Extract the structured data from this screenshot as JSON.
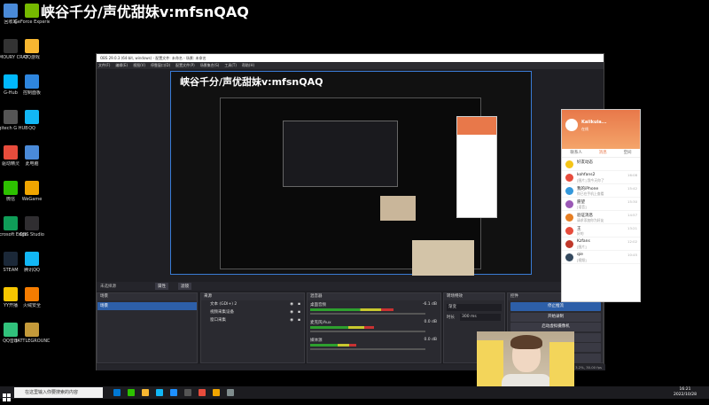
{
  "overlay": {
    "title": "峡谷千分/声优甜妹v:mfsnQAQ",
    "nested_title": "峡谷千分/声优甜妹v:mfsnQAQ"
  },
  "desktop_icons": [
    {
      "label": "回收站",
      "color": "#4a8ad8"
    },
    {
      "label": "GeForce Experience",
      "color": "#76b900"
    },
    {
      "label": "ARMOURY CRATE",
      "color": "#333"
    },
    {
      "label": "QQ游戏",
      "color": "#f7b731"
    },
    {
      "label": "G-Hub",
      "color": "#00b8fc"
    },
    {
      "label": "控制面板",
      "color": "#2e86de"
    },
    {
      "label": "Logitech G HUB",
      "color": "#555"
    },
    {
      "label": "QQ",
      "color": "#12b7f5"
    },
    {
      "label": "驱动精灵",
      "color": "#e74c3c"
    },
    {
      "label": "此电脑",
      "color": "#4a8ad8"
    },
    {
      "label": "微信",
      "color": "#2dc100"
    },
    {
      "label": "WeGame",
      "color": "#f0a500"
    },
    {
      "label": "Microsoft Edge",
      "color": "#0f9d58"
    },
    {
      "label": "OBS Studio",
      "color": "#302e31"
    },
    {
      "label": "STEAM",
      "color": "#1b2838"
    },
    {
      "label": "腾讯QQ",
      "color": "#12b7f5"
    },
    {
      "label": "YY开播",
      "color": "#f7c600"
    },
    {
      "label": "火绒安全",
      "color": "#f57c00"
    },
    {
      "label": "QQ音乐",
      "color": "#31c27c"
    },
    {
      "label": "BATTLEGROUNDS",
      "color": "#c49a3a"
    }
  ],
  "obs": {
    "window_title": "OBS 29.0.3 (64-bit, windows) - 配置文件: 未命名 - 场景: 未命名",
    "menu": [
      "文件(F)",
      "编辑(E)",
      "视图(V)",
      "停靠窗口(D)",
      "配置文件(P)",
      "场景集合(S)",
      "工具(T)",
      "帮助(H)"
    ],
    "source_label": "未选择源",
    "properties_btn": "属性",
    "filters_btn": "滤镜",
    "panels": {
      "scenes": {
        "title": "场景",
        "items": [
          "场景"
        ]
      },
      "sources": {
        "title": "来源",
        "items": [
          "文本 (GDI+) 2",
          "视频采集设备",
          "窗口采集"
        ]
      },
      "mixer": {
        "title": "混音器",
        "tracks": [
          {
            "name": "桌面音频",
            "db": "-6.1 dB",
            "level": 0.72
          },
          {
            "name": "麦克风/Aux",
            "db": "0.0 dB",
            "level": 0.55
          },
          {
            "name": "媒体源",
            "db": "0.0 dB",
            "level": 0.4
          }
        ]
      },
      "transitions": {
        "title": "转场特效",
        "fade": "渐变",
        "duration_label": "时长",
        "duration": "300 ms"
      },
      "controls": {
        "title": "控件",
        "buttons": [
          "停止推流",
          "开始录制",
          "启动虚拟摄像机",
          "工作室模式",
          "设置",
          "退出"
        ]
      }
    },
    "status": "LIVE: 00:00:00  REC: 00:00:00  CPU: 3.2%, 30.00 fps"
  },
  "chat": {
    "username": "Kaiikuia...",
    "status": "在线",
    "tabs": [
      "联系人",
      "消息",
      "空间"
    ],
    "rows": [
      {
        "name": "好友动态",
        "msg": "",
        "time": "",
        "color": "#f5c518"
      },
      {
        "name": "kohfans2",
        "msg": "[图片] 我今天你了",
        "time": "16:08",
        "color": "#e74c3c"
      },
      {
        "name": "我的iPhone",
        "msg": "你已在手机上查看",
        "time": "15:42",
        "color": "#3498db"
      },
      {
        "name": "愿望",
        "msg": "[语音]",
        "time": "15:30",
        "color": "#9b59b6"
      },
      {
        "name": "验证消息",
        "msg": "请求添加你为好友",
        "time": "14:57",
        "color": "#e67e22"
      },
      {
        "name": "王",
        "msg": "好的",
        "time": "13:21",
        "color": "#e74c3c"
      },
      {
        "name": "Kzfans",
        "msg": "[图片]",
        "time": "12:02",
        "color": "#c0392b"
      },
      {
        "name": "qie",
        "msg": "[视频]",
        "time": "10:45",
        "color": "#34495e"
      }
    ]
  },
  "taskbar": {
    "search_placeholder": "在这里输入你要搜索的内容",
    "time": "16:21",
    "date": "2022/10/28",
    "icons": [
      "#0078d4",
      "#2dc100",
      "#f7b731",
      "#12b7f5",
      "#1e90ff",
      "#555",
      "#e74c3c",
      "#f0a500",
      "#7f8c8d"
    ]
  }
}
